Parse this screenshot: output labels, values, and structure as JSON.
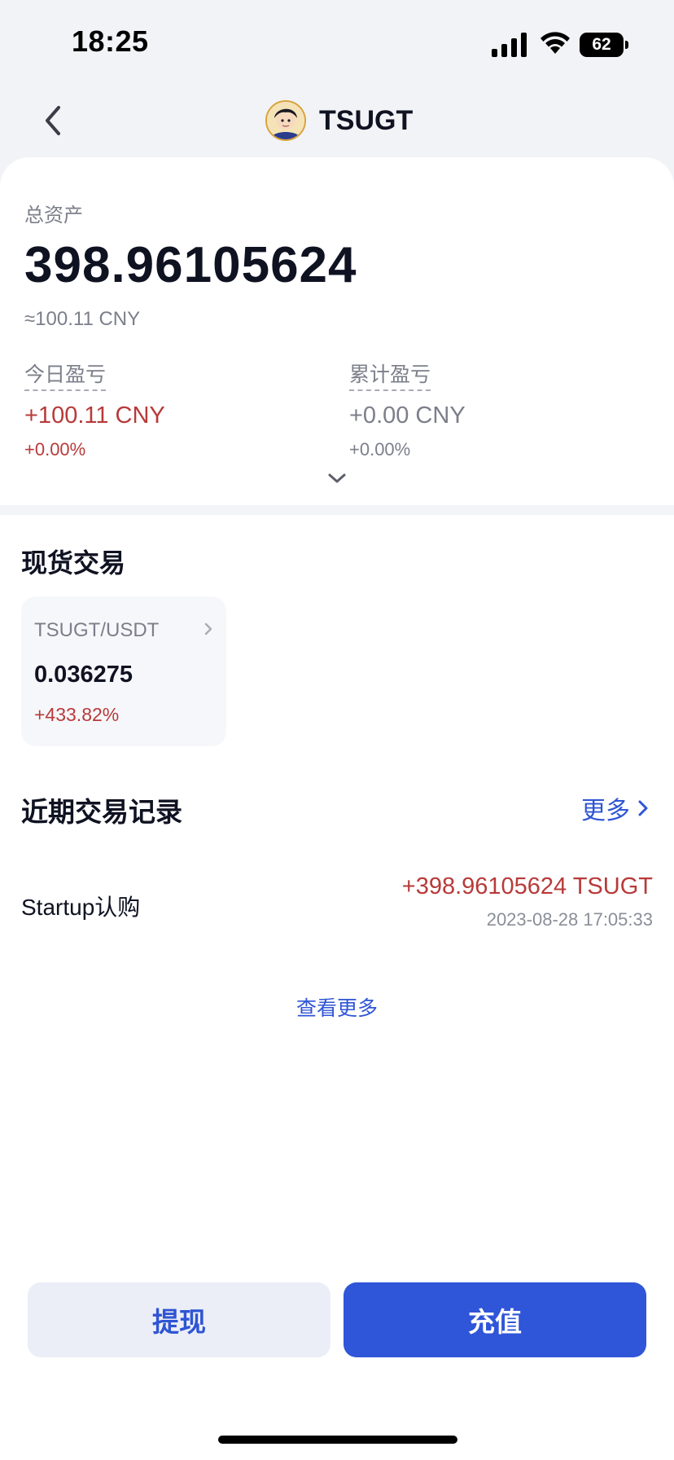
{
  "status_bar": {
    "time": "18:25",
    "battery": "62",
    "icons": [
      "signal-icon",
      "wifi-icon",
      "battery-icon"
    ]
  },
  "header": {
    "title": "TSUGT",
    "back_icon": "chevron-left-icon",
    "avatar": "token-avatar"
  },
  "assets": {
    "label": "总资产",
    "total": "398.96105624",
    "approx": "≈100.11 CNY"
  },
  "pnl": {
    "today": {
      "label": "今日盈亏",
      "amount": "+100.11 CNY",
      "percent": "+0.00%"
    },
    "cumulative": {
      "label": "累计盈亏",
      "amount": "+0.00 CNY",
      "percent": "+0.00%"
    }
  },
  "spot": {
    "title": "现货交易",
    "pair": "TSUGT/USDT",
    "price": "0.036275",
    "change": "+433.82%"
  },
  "recent": {
    "title": "近期交易记录",
    "more_label": "更多",
    "transactions": [
      {
        "name": "Startup认购",
        "amount": "+398.96105624 TSUGT",
        "time": "2023-08-28 17:05:33"
      }
    ],
    "view_more": "查看更多"
  },
  "actions": {
    "withdraw": "提现",
    "deposit": "充值"
  },
  "colors": {
    "accent": "#2f55d8",
    "positive_red": "#b83a3a",
    "muted": "#7c7f8a",
    "background_top": "#f2f3f7"
  }
}
